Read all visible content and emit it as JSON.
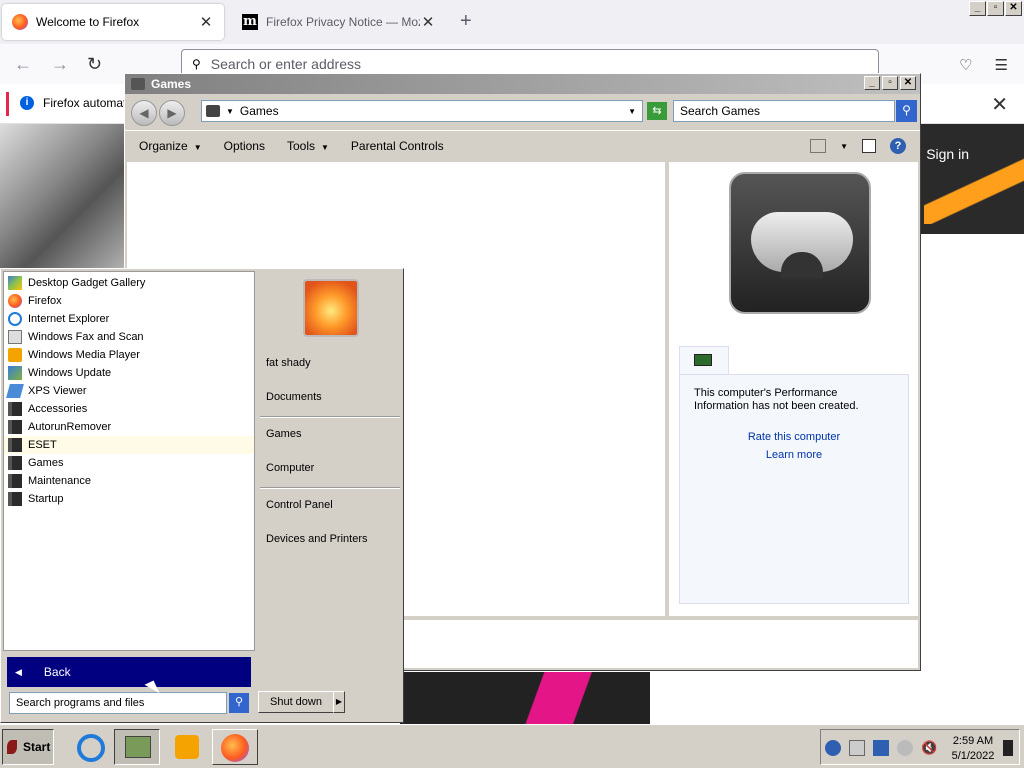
{
  "firefox": {
    "tabs": [
      {
        "label": "Welcome to Firefox",
        "close": "✕"
      },
      {
        "label": "Firefox Privacy Notice — Mozilla",
        "close": "✕"
      }
    ],
    "new_tab": "+",
    "favicon_m": "m",
    "window_controls": [
      "_",
      "▫",
      "✕"
    ],
    "url_placeholder": "Search or enter address",
    "notification": "Firefox automati",
    "notification_close": "✕",
    "content_sign_in": "Sign in"
  },
  "games_window": {
    "title": "Games",
    "controls": [
      "_",
      "▫",
      "✕"
    ],
    "back": "◀",
    "forward": "▶",
    "address": "Games",
    "search_placeholder": "Search Games",
    "toolbar": {
      "organize": "Organize",
      "options": "Options",
      "tools": "Tools",
      "parental": "Parental Controls"
    },
    "perf_message": "This computer's Performance Information has not been created.",
    "rate_link": "Rate this computer",
    "learn_link": "Learn more"
  },
  "start_menu": {
    "programs": [
      {
        "label": "Desktop Gadget Gallery",
        "icon": "gadget-icon"
      },
      {
        "label": "Firefox",
        "icon": "firefox-icon"
      },
      {
        "label": "Internet Explorer",
        "icon": "ie-icon"
      },
      {
        "label": "Windows Fax and Scan",
        "icon": "fax-icon"
      },
      {
        "label": "Windows Media Player",
        "icon": "media-player-icon"
      },
      {
        "label": "Windows Update",
        "icon": "windows-update-icon"
      },
      {
        "label": "XPS Viewer",
        "icon": "xps-icon"
      },
      {
        "label": "Accessories",
        "icon": "folder-icon"
      },
      {
        "label": "AutorunRemover",
        "icon": "folder-icon"
      },
      {
        "label": "ESET",
        "icon": "folder-icon"
      },
      {
        "label": "Games",
        "icon": "folder-icon"
      },
      {
        "label": "Maintenance",
        "icon": "folder-icon"
      },
      {
        "label": "Startup",
        "icon": "folder-icon"
      }
    ],
    "back": "Back",
    "search_placeholder": "Search programs and files",
    "user": "fat shady",
    "documents": "Documents",
    "games": "Games",
    "computer": "Computer",
    "control_panel": "Control Panel",
    "devices": "Devices and Printers",
    "shutdown": "Shut down"
  },
  "taskbar": {
    "start": "Start",
    "time": "2:59 AM",
    "date": "5/1/2022"
  }
}
